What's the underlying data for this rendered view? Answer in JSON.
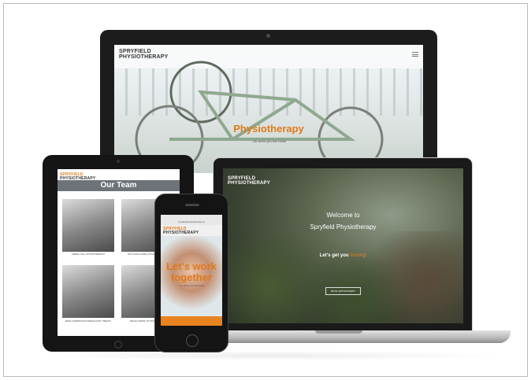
{
  "brand": {
    "line1": "SPRYFIELD",
    "line2": "PHYSIOTHERAPY",
    "accent": "#e07a1a"
  },
  "monitor": {
    "title": "Physiotherapy",
    "subtitle": "...for when you feel better"
  },
  "laptop": {
    "welcome": "Welcome to",
    "brand_name": "Spryfield Physiotherapy",
    "tagline_prefix": "Let's get you ",
    "tagline_accent": "moving!",
    "button": "BOOK APPOINTMENT"
  },
  "tablet": {
    "heading": "Our Team",
    "members": [
      {
        "caption": "SHERRY TALK, PHYSIOTHERAPIST"
      },
      {
        "caption": "RHYS DAVIS-JONES, PHYSIOTHERAPIST"
      },
      {
        "caption": "EMMA CUMMINGHAM KINESIOLOGIST THERAPY"
      },
      {
        "caption": "MEGAN HARRIS, PHYSIOTHERAPIST"
      }
    ]
  },
  "phone": {
    "url": "spryfieldphysiotherapy.ca",
    "headline_1": "Let's work",
    "headline_2": "together",
    "tagline": "...for when you feel better"
  }
}
